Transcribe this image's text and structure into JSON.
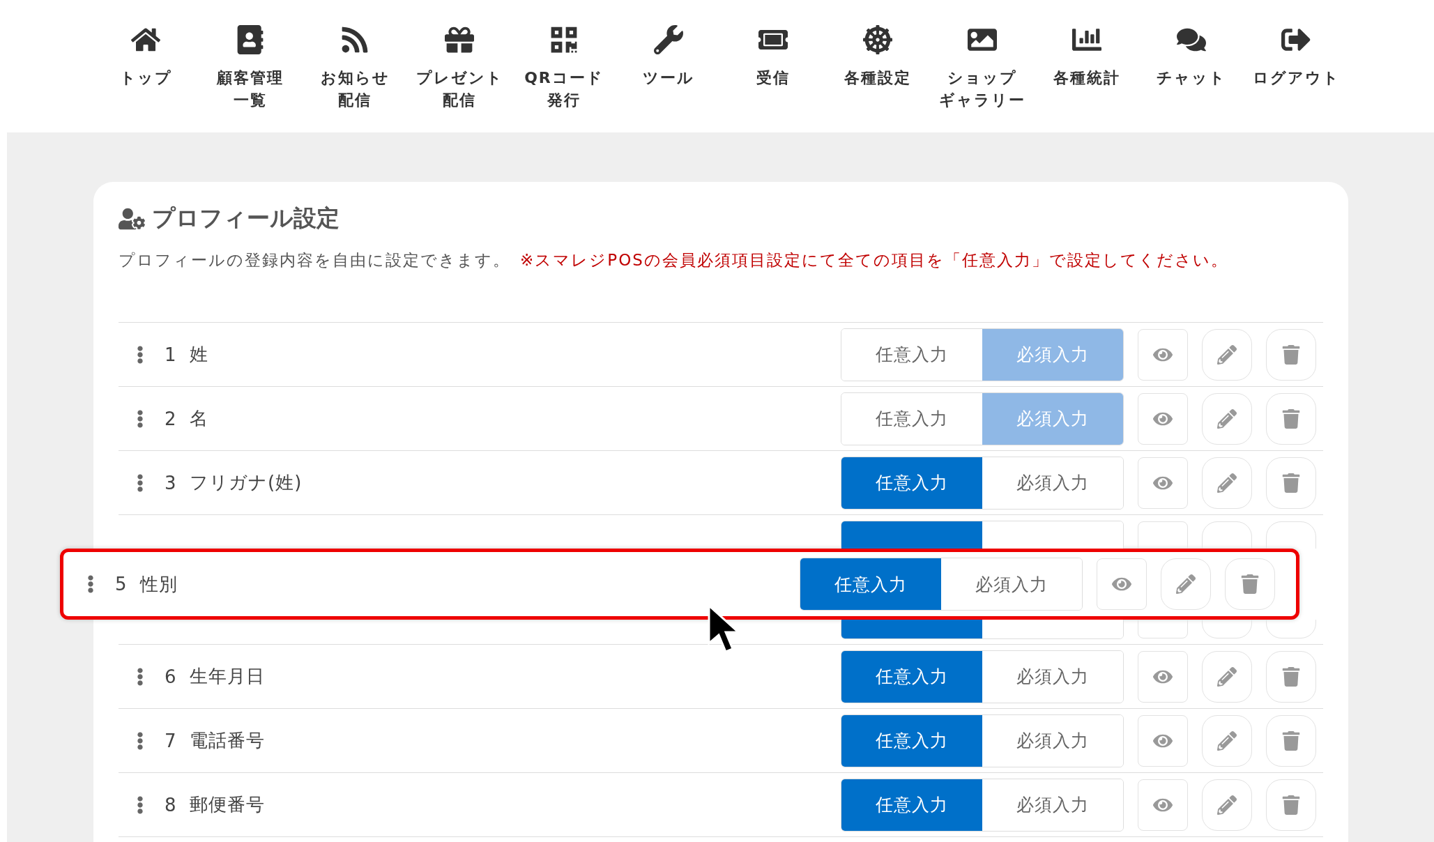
{
  "nav": [
    {
      "lines": [
        "トップ"
      ]
    },
    {
      "lines": [
        "顧客管理",
        "一覧"
      ]
    },
    {
      "lines": [
        "お知らせ",
        "配信"
      ]
    },
    {
      "lines": [
        "プレゼント",
        "配信"
      ]
    },
    {
      "lines": [
        "QRコード",
        "発行"
      ]
    },
    {
      "lines": [
        "ツール"
      ]
    },
    {
      "lines": [
        "受信"
      ]
    },
    {
      "lines": [
        "各種設定"
      ]
    },
    {
      "lines": [
        "ショップ",
        "ギャラリー"
      ]
    },
    {
      "lines": [
        "各種統計"
      ]
    },
    {
      "lines": [
        "チャット"
      ]
    },
    {
      "lines": [
        "ログアウト"
      ]
    }
  ],
  "panel": {
    "title": "プロフィール設定",
    "description": "プロフィールの登録内容を自由に設定できます。",
    "notice": "※スマレジPOSの会員必須項目設定にて全ての項目を「任意入力」で設定してください。"
  },
  "rows": [
    {
      "kind": "field",
      "number": "1",
      "label": "姓",
      "locked": true,
      "options": [
        {
          "label": "任意入力",
          "selected": false
        },
        {
          "label": "必須入力",
          "selected": true
        }
      ]
    },
    {
      "kind": "field",
      "number": "2",
      "label": "名",
      "locked": true,
      "options": [
        {
          "label": "任意入力",
          "selected": false
        },
        {
          "label": "必須入力",
          "selected": true
        }
      ]
    },
    {
      "kind": "field",
      "number": "3",
      "label": "フリガナ(姓)",
      "locked": false,
      "options": [
        {
          "label": "任意入力",
          "selected": true
        },
        {
          "label": "必須入力",
          "selected": false
        }
      ]
    },
    {
      "kind": "covered-top",
      "options": [
        {
          "selected": true
        },
        {
          "selected": false
        }
      ]
    },
    {
      "kind": "dragged",
      "number": "5",
      "label": "性別",
      "locked": false,
      "options": [
        {
          "label": "任意入力",
          "selected": true
        },
        {
          "label": "必須入力",
          "selected": false
        }
      ]
    },
    {
      "kind": "covered-bottom",
      "options": [
        {
          "selected": true
        },
        {
          "selected": false
        }
      ]
    },
    {
      "kind": "field",
      "number": "6",
      "label": "生年月日",
      "locked": false,
      "options": [
        {
          "label": "任意入力",
          "selected": true
        },
        {
          "label": "必須入力",
          "selected": false
        }
      ]
    },
    {
      "kind": "field",
      "number": "7",
      "label": "電話番号",
      "locked": false,
      "options": [
        {
          "label": "任意入力",
          "selected": true
        },
        {
          "label": "必須入力",
          "selected": false
        }
      ]
    },
    {
      "kind": "field",
      "number": "8",
      "label": "郵便番号",
      "locked": false,
      "options": [
        {
          "label": "任意入力",
          "selected": true
        },
        {
          "label": "必須入力",
          "selected": false
        }
      ]
    }
  ]
}
